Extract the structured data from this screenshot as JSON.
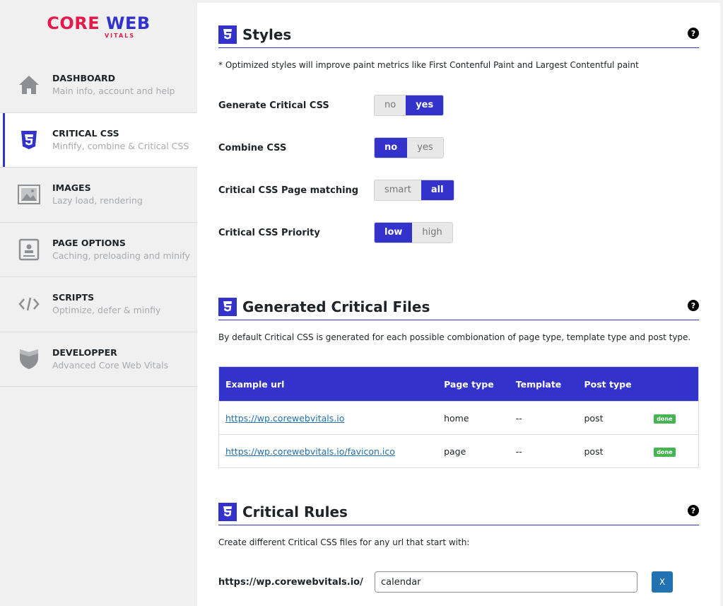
{
  "logo": {
    "main_left": "CORE",
    "main_right": "WEB",
    "sub": "VITALS"
  },
  "sidebar": {
    "items": [
      {
        "title": "DASHBOARD",
        "subtitle": "Main info, account and help",
        "icon": "home-icon"
      },
      {
        "title": "CRITICAL CSS",
        "subtitle": "Minfify, combine & Critical CSS",
        "icon": "css3-icon",
        "active": true
      },
      {
        "title": "IMAGES",
        "subtitle": "Lazy load, rendering",
        "icon": "image-icon"
      },
      {
        "title": "PAGE OPTIONS",
        "subtitle": "Caching, preloading and minify",
        "icon": "page-icon"
      },
      {
        "title": "SCRIPTS",
        "subtitle": "Optimize, defer & minfiy",
        "icon": "code-icon"
      },
      {
        "title": "DEVELOPPER",
        "subtitle": "Advanced Core Web Vitals",
        "icon": "shield-icon"
      }
    ]
  },
  "styles": {
    "title": "Styles",
    "help": "?",
    "desc": "* Optimized styles will improve paint metrics like First Contenful Paint and Largest Contentful paint",
    "options": [
      {
        "label": "Generate Critical CSS",
        "choices": [
          "no",
          "yes"
        ],
        "selected": "yes"
      },
      {
        "label": "Combine CSS",
        "choices": [
          "no",
          "yes"
        ],
        "selected": "no"
      },
      {
        "label": "Critical CSS Page matching",
        "choices": [
          "smart",
          "all"
        ],
        "selected": "all"
      },
      {
        "label": "Critical CSS Priority",
        "choices": [
          "low",
          "high"
        ],
        "selected": "low"
      }
    ]
  },
  "files": {
    "title": "Generated Critical Files",
    "help": "?",
    "desc": "By default Critical CSS is generated for each possible combionation of page type, template type and post type.",
    "headers": [
      "Example url",
      "Page type",
      "Template",
      "Post type",
      ""
    ],
    "rows": [
      {
        "url": "https://wp.corewebvitals.io",
        "page_type": "home",
        "template": "--",
        "post_type": "post",
        "status": "done"
      },
      {
        "url": "https://wp.corewebvitals.io/favicon.ico",
        "page_type": "page",
        "template": "--",
        "post_type": "post",
        "status": "done"
      }
    ]
  },
  "rules": {
    "title": "Critical Rules",
    "help": "?",
    "desc": "Create different Critical CSS files for any url that start with:",
    "prefix": "https://wp.corewebvitals.io/",
    "input_value": "calendar",
    "remove_label": "X"
  },
  "colors": {
    "accent": "#3333cc",
    "brand_red": "#e6194b",
    "link": "#2271b1",
    "done": "#46b450"
  }
}
